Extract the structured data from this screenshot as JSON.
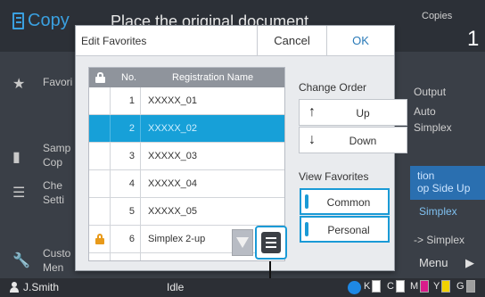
{
  "background": {
    "app_title": "Copy",
    "message": "Place the original document",
    "copies_label": "Copies",
    "copies_value": "1",
    "left_items": [
      {
        "label": "Favori"
      },
      {
        "label": "Samp\nCop"
      },
      {
        "label": "Che\nSetti"
      },
      {
        "label": "Custo\nMen"
      }
    ],
    "right_items": [
      "Output",
      "Auto",
      "Simplex",
      "tion",
      "op Side Up",
      "Simplex",
      "-> Simplex"
    ],
    "menu_label": "Menu"
  },
  "dialog": {
    "title": "Edit Favorites",
    "cancel_label": "Cancel",
    "ok_label": "OK",
    "table": {
      "col_no": "No.",
      "col_name": "Registration Name",
      "rows": [
        {
          "no": "1",
          "name": "XXXXX_01",
          "locked": false,
          "selected": false
        },
        {
          "no": "2",
          "name": "XXXXX_02",
          "locked": false,
          "selected": true
        },
        {
          "no": "3",
          "name": "XXXXX_03",
          "locked": false,
          "selected": false
        },
        {
          "no": "4",
          "name": "XXXXX_04",
          "locked": false,
          "selected": false
        },
        {
          "no": "5",
          "name": "XXXXX_05",
          "locked": false,
          "selected": false
        },
        {
          "no": "6",
          "name": "Simplex 2-up",
          "locked": true,
          "selected": false
        }
      ]
    },
    "change_order_label": "Change Order",
    "up_label": "Up",
    "down_label": "Down",
    "view_favorites_label": "View Favorites",
    "common_label": "Common",
    "personal_label": "Personal"
  },
  "status": {
    "user": "J.Smith",
    "state": "Idle",
    "inks": [
      "K",
      "C",
      "M",
      "Y",
      "G"
    ]
  },
  "colors": {
    "accent": "#1a9ad6",
    "selected_row": "#17a0d8",
    "ink_m": "#d81b8a",
    "ink_y": "#f2d100",
    "ink_g": "#9e9e9e"
  }
}
